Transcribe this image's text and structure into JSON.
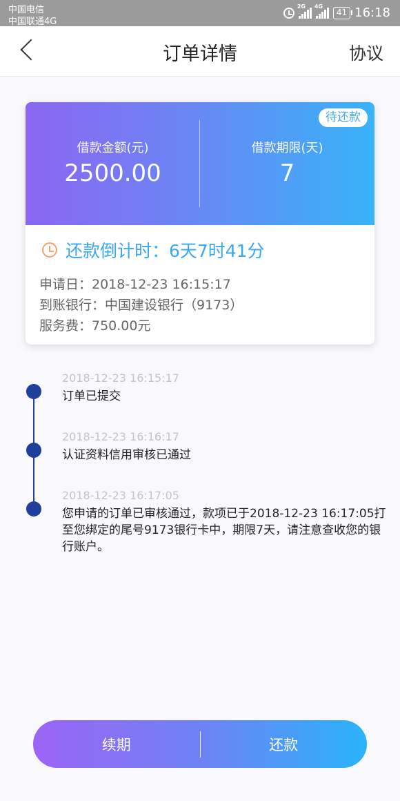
{
  "status_bar": {
    "carrier_1": "中国电信",
    "carrier_2": "中国联通4G",
    "signal_1_label": "2G",
    "signal_2_label": "4G",
    "battery": "41",
    "time": "16:18"
  },
  "nav": {
    "title": "订单详情",
    "right_label": "协议"
  },
  "loan_card": {
    "status_tag": "待还款",
    "amount_label": "借款金额(元)",
    "amount_value": "2500.00",
    "term_label": "借款期限(天)",
    "term_value": "7",
    "countdown": "还款倒计时：6天7时41分",
    "apply_date": "申请日：2018-12-23 16:15:17",
    "bank": "到账银行：中国建设银行（9173）",
    "service_fee": "服务费：750.00元"
  },
  "timeline": [
    {
      "time": "2018-12-23 16:15:17",
      "text": "订单已提交"
    },
    {
      "time": "2018-12-23 16:16:17",
      "text": "认证资料信用审核已通过"
    },
    {
      "time": "2018-12-23 16:17:05",
      "text": "您申请的订单已审核通过，款项已于2018-12-23 16:17:05打至您绑定的尾号9173银行卡中，期限7天，请注意查收您的银行账户。"
    }
  ],
  "actions": {
    "renew": "续期",
    "repay": "还款"
  },
  "icons": {
    "back": "chevron-left-icon",
    "clock": "clock-icon",
    "alarm": "alarm-icon"
  },
  "colors": {
    "accent_blue": "#3aa7f2",
    "gradient_start": "#8c66f2",
    "gradient_end": "#37b3f8",
    "timeline_dot": "#1e3f9a",
    "clock_orange": "#f5a36a"
  }
}
